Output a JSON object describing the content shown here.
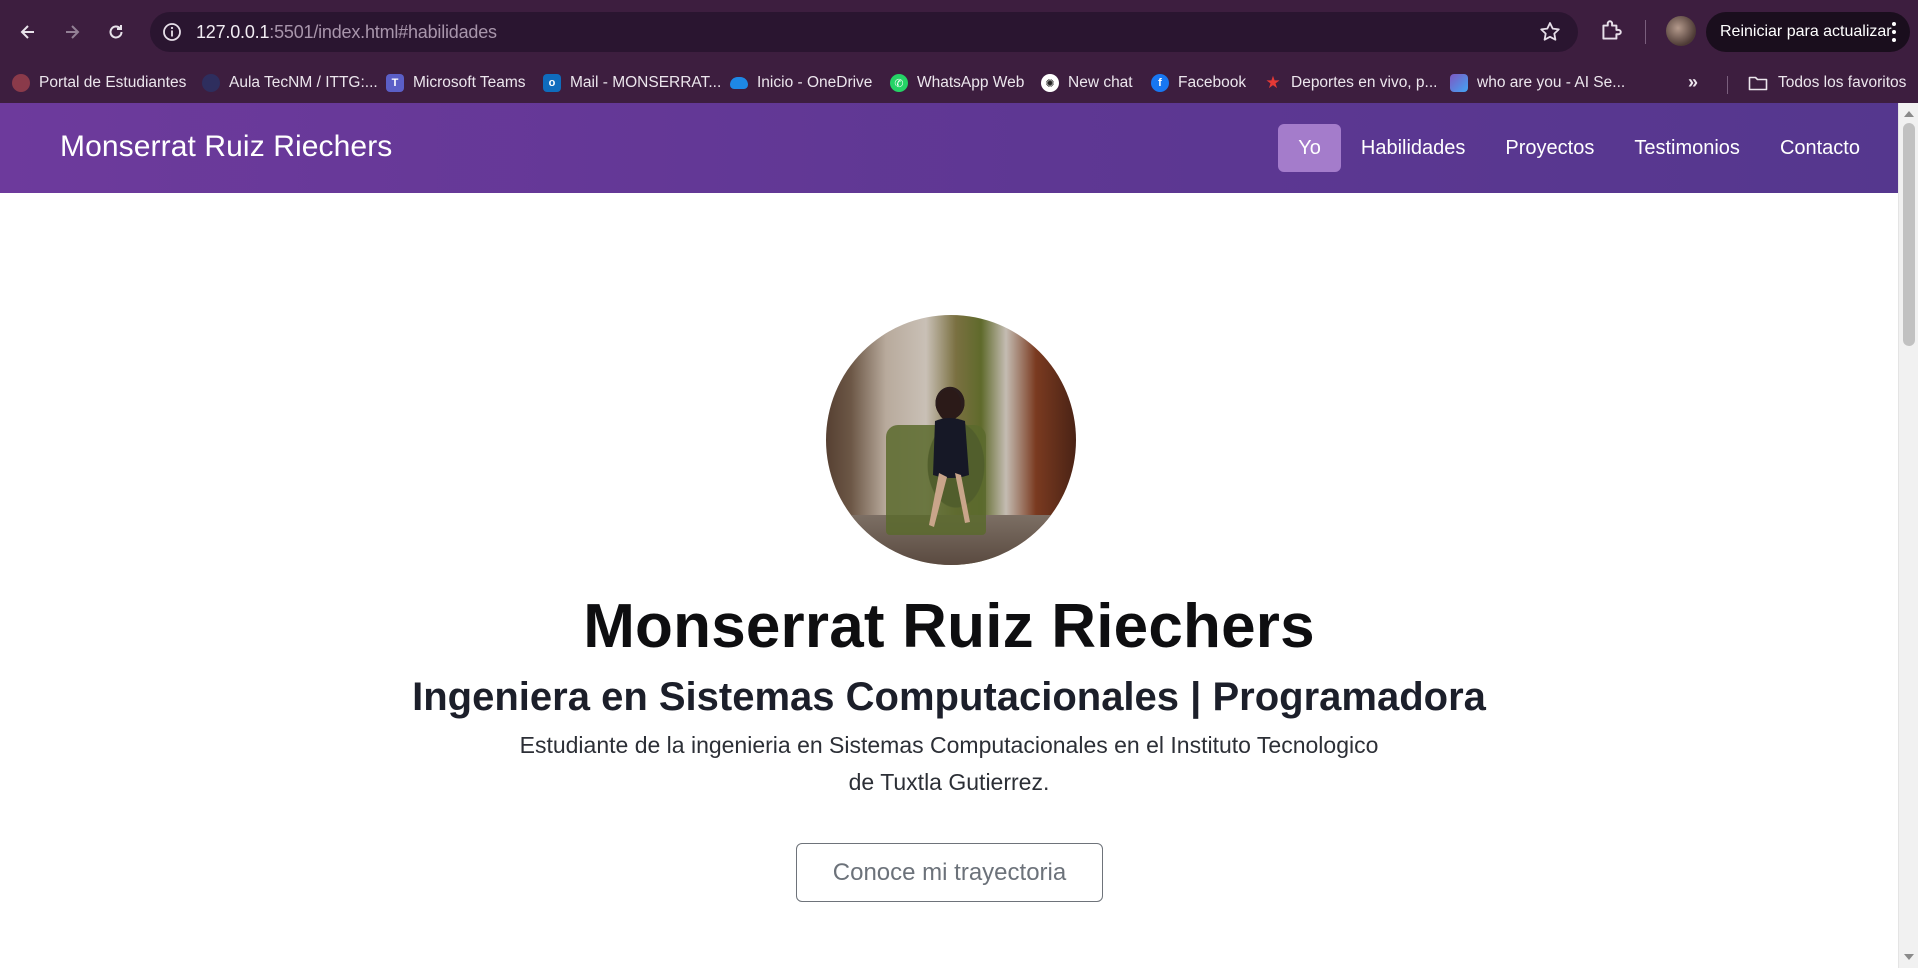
{
  "browser": {
    "url_host": "127.0.0.1",
    "url_rest": ":5501/index.html#habilidades",
    "update_button": "Reiniciar para actualizar",
    "bookmarks": [
      {
        "label": "Portal de Estudiantes",
        "icon": "portal-icon",
        "color": "#8a3a4a"
      },
      {
        "label": "Aula TecNM / ITTG:...",
        "icon": "aula-icon",
        "color": "#2e2e5e"
      },
      {
        "label": "Microsoft Teams",
        "icon": "teams-icon",
        "color": "#5b5fc7"
      },
      {
        "label": "Mail - MONSERRAT...",
        "icon": "outlook-icon",
        "color": "#0f6cbd"
      },
      {
        "label": "Inicio - OneDrive",
        "icon": "onedrive-icon",
        "color": "#1e88e5"
      },
      {
        "label": "WhatsApp Web",
        "icon": "whatsapp-icon",
        "color": "#25d366"
      },
      {
        "label": "New chat",
        "icon": "openai-icon",
        "color": "#ffffff"
      },
      {
        "label": "Facebook",
        "icon": "facebook-icon",
        "color": "#1877f2"
      },
      {
        "label": "Deportes en vivo, p...",
        "icon": "star-icon",
        "color": "#e53935"
      },
      {
        "label": "who are you - AI Se...",
        "icon": "ai-icon",
        "color": "#7e57c2"
      }
    ],
    "all_bookmarks": "Todos los favoritos"
  },
  "site": {
    "brand": "Monserrat Ruiz Riechers",
    "nav": [
      {
        "label": "Yo",
        "active": true
      },
      {
        "label": "Habilidades",
        "active": false
      },
      {
        "label": "Proyectos",
        "active": false
      },
      {
        "label": "Testimonios",
        "active": false
      },
      {
        "label": "Contacto",
        "active": false
      }
    ],
    "accent": "#5e3793"
  },
  "hero": {
    "name": "Monserrat Ruiz Riechers",
    "role": "Ingeniera en Sistemas Computacionales | Programadora",
    "description_line1": "Estudiante de la ingenieria en Sistemas Computacionales en el Instituto Tecnologico",
    "description_line2": "de Tuxtla Gutierrez.",
    "cta": "Conoce mi trayectoria"
  }
}
